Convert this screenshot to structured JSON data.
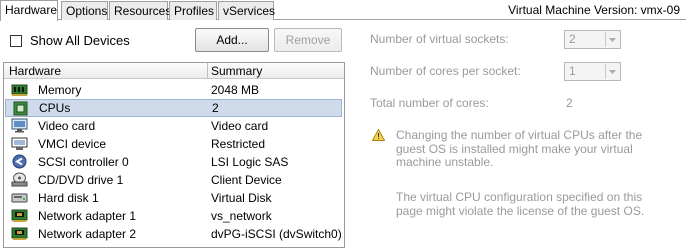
{
  "tabs": [
    {
      "label": "Hardware",
      "active": true
    },
    {
      "label": "Options",
      "active": false
    },
    {
      "label": "Resources",
      "active": false
    },
    {
      "label": "Profiles",
      "active": false
    },
    {
      "label": "vServices",
      "active": false
    }
  ],
  "vm_version": "Virtual Machine Version: vmx-09",
  "show_all_devices": {
    "label": "Show All Devices",
    "checked": false
  },
  "buttons": {
    "add": "Add...",
    "remove": "Remove"
  },
  "hardware_table": {
    "columns": [
      "Hardware",
      "Summary"
    ],
    "rows": [
      {
        "icon": "memory-icon",
        "name": "Memory",
        "summary": "2048 MB"
      },
      {
        "icon": "cpu-icon",
        "name": "CPUs",
        "summary": "2",
        "selected": true
      },
      {
        "icon": "video-card-icon",
        "name": "Video card",
        "summary": "Video card"
      },
      {
        "icon": "vmci-device-icon",
        "name": "VMCI device",
        "summary": "Restricted"
      },
      {
        "icon": "scsi-controller-icon",
        "name": "SCSI controller 0",
        "summary": "LSI Logic SAS"
      },
      {
        "icon": "cd-dvd-drive-icon",
        "name": "CD/DVD drive 1",
        "summary": "Client Device"
      },
      {
        "icon": "hard-disk-icon",
        "name": "Hard disk 1",
        "summary": "Virtual Disk"
      },
      {
        "icon": "network-adapter-icon",
        "name": "Network adapter 1",
        "summary": "vs_network"
      },
      {
        "icon": "network-adapter-icon",
        "name": "Network adapter 2",
        "summary": "dvPG-iSCSI (dvSwitch0),..."
      }
    ]
  },
  "cpu_settings": {
    "sockets_label": "Number of virtual sockets:",
    "sockets_value": "2",
    "cores_label": "Number of cores per socket:",
    "cores_value": "1",
    "total_label": "Total number of cores:",
    "total_value": "2",
    "warning_icon": "warning-icon",
    "warning_text": "Changing the number of virtual CPUs after the guest OS is installed might make your virtual machine unstable.",
    "license_text": "The virtual CPU configuration specified on this page might violate the license of the guest OS."
  },
  "colors": {
    "selected_row": "#cfdbea",
    "disabled_text": "#9a9a9a",
    "tab_border": "#a0a0a0",
    "warning_yellow": "#f3d24b"
  }
}
